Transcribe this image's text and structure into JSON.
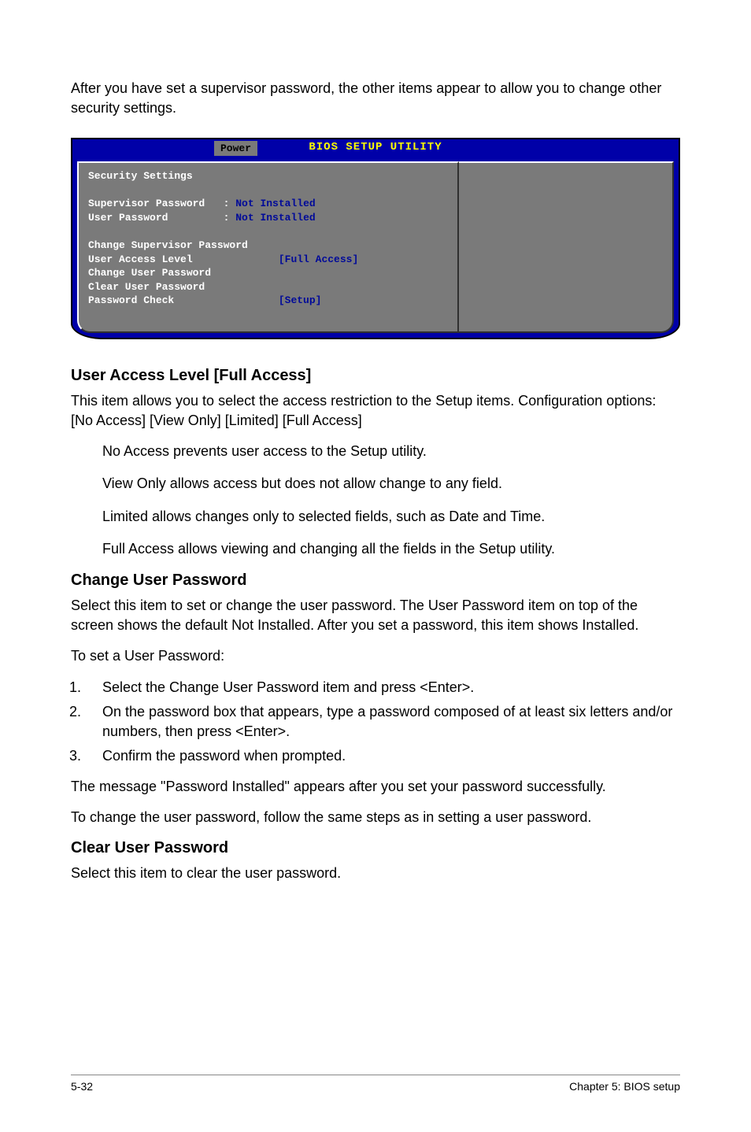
{
  "intro": "After you have set a supervisor password, the other items appear to allow you to change other security settings.",
  "bios": {
    "title": "BIOS SETUP UTILITY",
    "tab": "Power",
    "heading": "Security Settings",
    "rows": {
      "supervisor_label": "Supervisor Password",
      "supervisor_val": "Not Installed",
      "user_label": "User Password",
      "user_val": "Not Installed",
      "change_sup": "Change Supervisor Password",
      "access_label": "User Access Level",
      "access_val": "[Full Access]",
      "change_user": "Change User Password",
      "clear_user": "Clear User Password",
      "check_label": "Password Check",
      "check_val": "[Setup]"
    }
  },
  "sections": {
    "ual_heading": "User Access Level [Full Access]",
    "ual_p1": "This item allows you to select the access restriction to the Setup items. Configuration options: [No Access] [View Only] [Limited] [Full Access]",
    "ual_i1": "No Access prevents user access to the Setup utility.",
    "ual_i2": "View Only allows access but does not allow change to any field.",
    "ual_i3": "Limited allows changes only to selected fields, such as Date and Time.",
    "ual_i4": "Full Access allows viewing and changing all the fields in the Setup utility.",
    "cup_heading": "Change User Password",
    "cup_p1": "Select this item to set or change the user password. The User Password item on top of the screen shows the default Not Installed. After you set a password, this item shows Installed.",
    "cup_p2": "To set a User Password:",
    "cup_li1": "Select the Change User Password item and press <Enter>.",
    "cup_li2": "On the password box that appears, type a password composed of at least six letters and/or numbers, then press <Enter>.",
    "cup_li3": "Confirm the password when prompted.",
    "cup_p3": "The message \"Password Installed\" appears after you set your password successfully.",
    "cup_p4": "To change the user password, follow the same steps as in setting a user password.",
    "clr_heading": "Clear User Password",
    "clr_p1": "Select this item to clear the user password."
  },
  "footer": {
    "left": "5-32",
    "right": "Chapter 5: BIOS setup"
  }
}
